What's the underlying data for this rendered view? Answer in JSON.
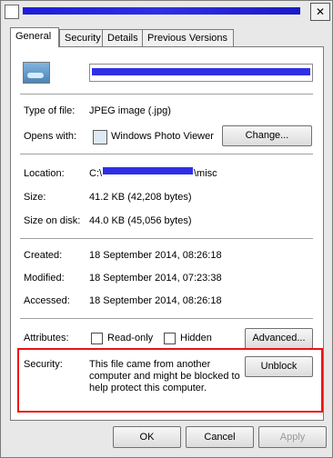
{
  "window": {
    "close_glyph": "✕"
  },
  "tabs": [
    {
      "label": "General"
    },
    {
      "label": "Security"
    },
    {
      "label": "Details"
    },
    {
      "label": "Previous Versions"
    }
  ],
  "general": {
    "type_of_file_label": "Type of file:",
    "type_of_file_value": "JPEG image (.jpg)",
    "opens_with_label": "Opens with:",
    "opens_with_value": "Windows Photo Viewer",
    "change_button": "Change...",
    "location_label": "Location:",
    "location_prefix": "C:\\",
    "location_suffix": "\\misc",
    "size_label": "Size:",
    "size_value": "41.2 KB (42,208 bytes)",
    "size_on_disk_label": "Size on disk:",
    "size_on_disk_value": "44.0 KB (45,056 bytes)",
    "created_label": "Created:",
    "created_value": "18 September 2014, 08:26:18",
    "modified_label": "Modified:",
    "modified_value": "18 September 2014, 07:23:38",
    "accessed_label": "Accessed:",
    "accessed_value": "18 September 2014, 08:26:18",
    "attributes_label": "Attributes:",
    "readonly_label": "Read-only",
    "hidden_label": "Hidden",
    "advanced_button": "Advanced...",
    "security_label": "Security:",
    "security_text_1": "This file came from another",
    "security_text_2": "computer and might be blocked to",
    "security_text_3": "help protect this computer.",
    "unblock_button": "Unblock"
  },
  "footer": {
    "ok": "OK",
    "cancel": "Cancel",
    "apply": "Apply"
  },
  "colors": {
    "accent_redaction": "#2f2fe6",
    "highlight_box": "#e11"
  }
}
